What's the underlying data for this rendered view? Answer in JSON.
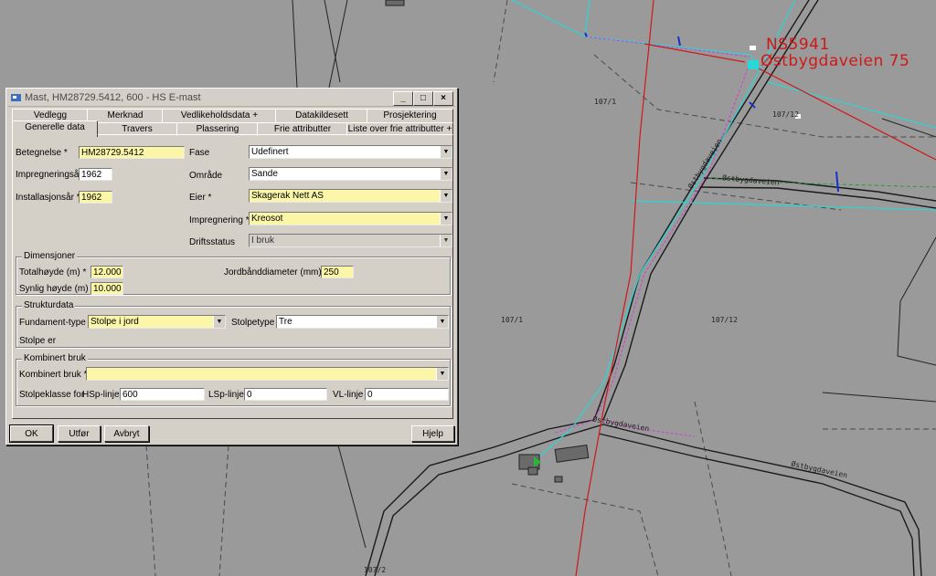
{
  "window": {
    "title": "Mast, HM28729.5412, 600 - HS E-mast",
    "minimize": "_",
    "maximize": "□",
    "close": "×"
  },
  "tabs_back": [
    "Vedlegg",
    "Merknad",
    "Vedlikeholdsdata +",
    "Datakildesett",
    "Prosjektering"
  ],
  "tabs_front": [
    "Generelle data",
    "Travers",
    "Plassering",
    "Frie attributter",
    "Liste over frie attributter +"
  ],
  "general": {
    "betegnelse_label": "Betegnelse *",
    "betegnelse_value": "HM28729.5412",
    "impregneringsar_label": "Impregneringsår",
    "impregneringsar_value": "1962",
    "installasjonsar_label": "Installasjonsår *",
    "installasjonsar_value": "1962",
    "fase_label": "Fase",
    "fase_value": "Udefinert",
    "omrade_label": "Område",
    "omrade_value": "Sande",
    "eier_label": "Eier *",
    "eier_value": "Skagerak Nett AS",
    "impregnering_label": "Impregnering *",
    "impregnering_value": "Kreosot",
    "driftsstatus_label": "Driftsstatus",
    "driftsstatus_value": "I bruk"
  },
  "dimensjoner": {
    "title": "Dimensjoner",
    "totalhoyde_label": "Totalhøyde (m) *",
    "totalhoyde_value": "12.000",
    "synlig_label": "Synlig høyde (m) *",
    "synlig_value": "10.000",
    "jordband_label": "Jordbånddiameter (mm) *",
    "jordband_value": "250"
  },
  "strukturdata": {
    "title": "Strukturdata",
    "fundament_label": "Fundament-type *",
    "fundament_value": "Stolpe i jord",
    "stolpetype_label": "Stolpetype",
    "stolpetype_value": "Tre",
    "stolpe_er_label": "Stolpe er"
  },
  "kombinert": {
    "title": "Kombinert bruk",
    "kombinert_label": "Kombinert bruk *",
    "kombinert_value": "",
    "stolpeklasse_label": "Stolpeklasse for",
    "hsp_label": "HSp-linje",
    "hsp_value": "600",
    "lsp_label": "LSp-linje",
    "lsp_value": "0",
    "vl_label": "VL-linje",
    "vl_value": "0"
  },
  "buttons": {
    "ok": "OK",
    "utfor": "Utfør",
    "avbryt": "Avbryt",
    "hjelp": "Hjelp"
  },
  "map": {
    "red_label_1": "NS5941",
    "red_label_2": "Østbygdaveien 75",
    "road_1": "Østbygdaveien",
    "road_2": "Østbygdaveien",
    "road_3": "Østbygdaveien",
    "road_4": "Østbygdaveien",
    "parcel_1": "107/1",
    "parcel_2": "107/12",
    "parcel_3": "107/1",
    "parcel_4": "107/12",
    "parcel_5": "107/2"
  }
}
